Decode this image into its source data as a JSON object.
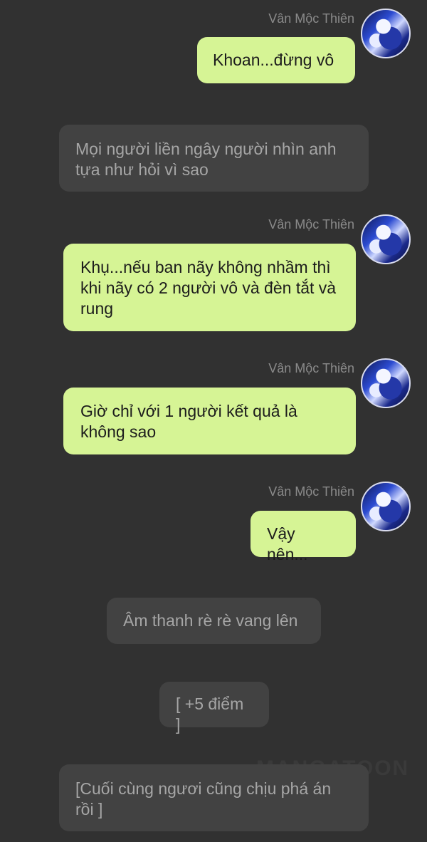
{
  "messages": [
    {
      "sender": "Vân Mộc Thiên",
      "text": "Khoan...đừng vô"
    },
    {
      "text": "Mọi người liền ngây người nhìn anh tựa như hỏi vì sao"
    },
    {
      "sender": "Vân Mộc Thiên",
      "text": "Khụ...nếu ban nãy không nhầm thì khi nãy có 2 người vô và đèn tắt và rung"
    },
    {
      "sender": "Vân Mộc Thiên",
      "text": "Giờ chỉ với 1 người kết quả là không sao"
    },
    {
      "sender": "Vân Mộc Thiên",
      "text": "Vậy nên..."
    },
    {
      "text": "Âm thanh rè rè vang lên"
    },
    {
      "text": "[ +5 điểm ]"
    },
    {
      "text": "[Cuối cùng ngươi cũng chịu phá án rồi ]"
    }
  ],
  "watermark": "MANGATOON",
  "colors": {
    "background": "#313131",
    "bubble_user": "#d6f495",
    "bubble_narration": "#424242"
  },
  "icons": {
    "avatar": "character-avatar-icon"
  }
}
